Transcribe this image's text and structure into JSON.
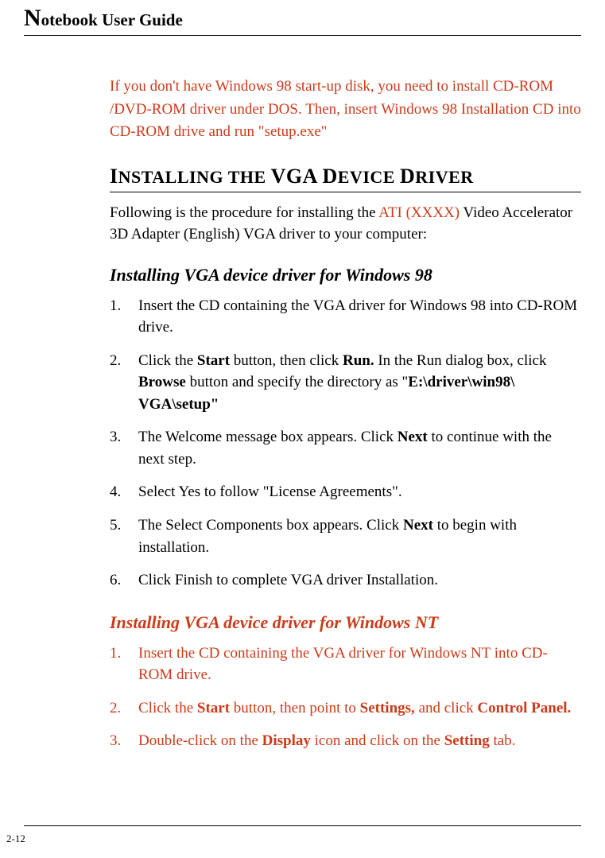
{
  "header": {
    "title_cap": "N",
    "title_rest": "otebook User Guide"
  },
  "intro": "If you don't have Windows 98 start-up disk, you need to install CD-ROM /DVD-ROM driver under DOS. Then, insert Windows 98 Installation CD into CD-ROM drive and run \"setup.exe\"",
  "section_heading_parts": {
    "p1c": "I",
    "p1": "NSTALLING THE ",
    "p2c": "VGA D",
    "p2": "EVICE ",
    "p3c": "D",
    "p3": "RIVER"
  },
  "body_intro": {
    "before": "Following is the procedure for installing the ",
    "hl": "ATI (XXXX)",
    "after": " Video Accelerator 3D Adapter (English) VGA driver to your computer:"
  },
  "sub1": "Installing VGA device driver for Windows 98",
  "steps1": {
    "s1": "Insert the CD containing the VGA driver for Windows 98 into CD-ROM drive.",
    "s2a": "Click the ",
    "s2b": "Start",
    "s2c": " button, then click ",
    "s2d": "Run.",
    "s2e": " In the Run dialog box, click ",
    "s2f": "Browse",
    "s2g": " button and specify the directory as \"",
    "s2h": "E:\\driver\\win98\\ VGA\\setup\"",
    "s3a": "The Welcome message box appears. Click ",
    "s3b": "Next",
    "s3c": " to continue with the next step.",
    "s4": "Select Yes to follow \"License Agreements\".",
    "s5a": "The Select Components box appears. Click ",
    "s5b": "Next",
    "s5c": " to begin with installation.",
    "s6": "Click Finish to complete VGA driver Installation."
  },
  "sub2": "Installing VGA device driver for Windows NT",
  "steps2": {
    "s1": "Insert the CD containing the VGA driver for Windows NT into CD-ROM drive.",
    "s2a": "Click the ",
    "s2b": "Start",
    "s2c": " button, then point to ",
    "s2d": "Settings,",
    "s2e": " and click ",
    "s2f": "Control Panel.",
    "s3a": "Double-click on the ",
    "s3b": "Display",
    "s3c": " icon and click on the ",
    "s3d": "Setting",
    "s3e": " tab."
  },
  "page_number": "2-12"
}
